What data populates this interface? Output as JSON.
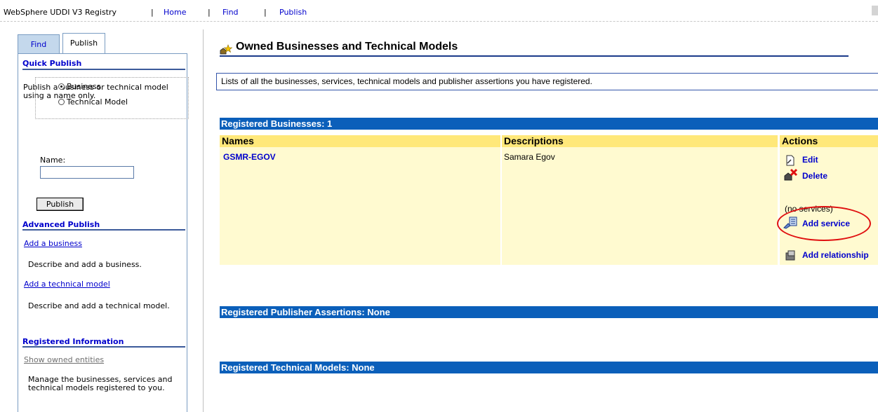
{
  "topbar": {
    "app_title": "WebSphere UDDI V3 Registry",
    "sep": "|",
    "home": "Home",
    "find": "Find",
    "publish": "Publish"
  },
  "sidebar": {
    "tabs": [
      {
        "label": "Find",
        "active": false
      },
      {
        "label": "Publish",
        "active": true
      }
    ],
    "quick_publish": {
      "heading": "Quick Publish",
      "description": "Publish a business or technical model using a name only.",
      "radio_business": "Business",
      "radio_technical": "Technical Model",
      "selected": "Business",
      "name_label": "Name:",
      "name_value": "",
      "publish_button": "Publish"
    },
    "advanced_publish": {
      "heading": "Advanced Publish",
      "add_business_link": "Add a business",
      "add_business_desc": "Describe and add a business.",
      "add_tmodel_link": "Add a technical model",
      "add_tmodel_desc": "Describe and add a technical model."
    },
    "registered_information": {
      "heading": "Registered Information",
      "show_owned_link": "Show owned entities",
      "show_owned_desc": "Manage the businesses, services and technical models registered to you."
    }
  },
  "main": {
    "title": "Owned Businesses and Technical Models",
    "description": "Lists of all the businesses, services, technical models and publisher assertions you have registered.",
    "registered_businesses": {
      "header": "Registered Businesses: 1",
      "columns": [
        "Names",
        "Descriptions",
        "Actions"
      ],
      "rows": [
        {
          "name": "GSMR-EGOV",
          "description": "Samara Egov",
          "actions": {
            "edit": "Edit",
            "delete": "Delete",
            "no_services": "(no services)",
            "add_service": "Add service",
            "add_relationship": "Add relationship"
          }
        }
      ]
    },
    "publisher_assertions": {
      "header": "Registered Publisher Assertions: None"
    },
    "technical_models": {
      "header": "Registered Technical Models: None"
    }
  },
  "colors": {
    "bar_blue": "#0b5fba",
    "column_header": "#ffe87a",
    "row_bg": "#fffad0",
    "link": "#0000cc",
    "highlight_oval": "#e01010"
  }
}
